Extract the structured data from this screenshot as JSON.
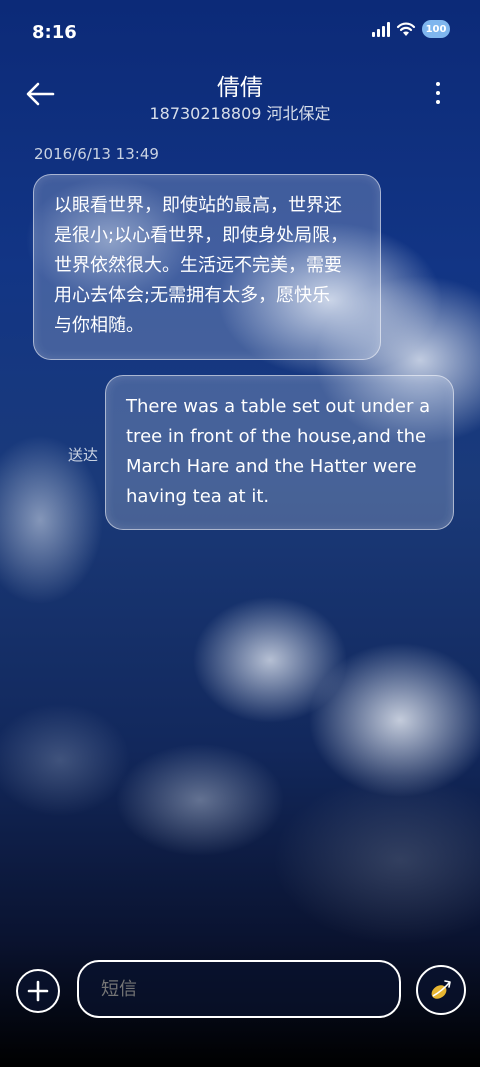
{
  "status": {
    "time": "8:16",
    "battery": "100"
  },
  "header": {
    "title": "倩倩",
    "subtitle": "18730218809 河北保定"
  },
  "messages": {
    "timestamp": "2016/6/13 13:49",
    "incoming": {
      "lines": [
        "以眼看世界，即使站的最高，世界还",
        "是很小;以心看世界，即使身处局限，",
        "世界依然很大。生活远不完美，需要",
        "用心去体会;无需拥有太多，愿快乐",
        "与你相随。"
      ]
    },
    "outgoing": {
      "lines": [
        "There was a table set out under a",
        "tree in front of the house,and the",
        "March Hare and the Hatter were",
        "having tea at it."
      ],
      "status": "送达"
    }
  },
  "composer": {
    "placeholder": "短信"
  },
  "icons": {
    "back": "arrow-left-icon",
    "menu": "more-vertical-icon",
    "add": "plus-icon",
    "send": "send-icon"
  }
}
